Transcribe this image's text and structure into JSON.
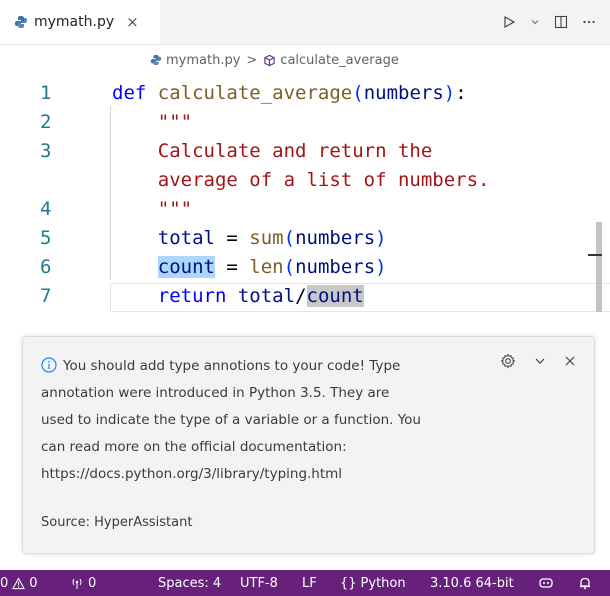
{
  "tab": {
    "filename": "mymath.py",
    "close": "×"
  },
  "breadcrumb": {
    "file": "mymath.py",
    "separator": ">",
    "symbol": "calculate_average"
  },
  "editor": {
    "lines": [
      {
        "num": "1",
        "parts": [
          {
            "t": "def",
            "c": "kw"
          },
          {
            "t": " "
          },
          {
            "t": "calculate_average",
            "c": "fn"
          },
          {
            "t": "(",
            "c": "paren"
          },
          {
            "t": "numbers",
            "c": "var"
          },
          {
            "t": ")",
            "c": "paren"
          },
          {
            "t": ":"
          }
        ]
      },
      {
        "num": "2",
        "parts": [
          {
            "t": "    \"\"\"",
            "c": "str"
          }
        ]
      },
      {
        "num": "3",
        "parts": [
          {
            "t": "    Calculate and return the",
            "c": "str"
          }
        ]
      },
      {
        "num": "",
        "parts": [
          {
            "t": "    average of a list of numbers.",
            "c": "str"
          }
        ]
      },
      {
        "num": "4",
        "parts": [
          {
            "t": "    \"\"\"",
            "c": "str"
          }
        ]
      },
      {
        "num": "5",
        "parts": [
          {
            "t": "    "
          },
          {
            "t": "total",
            "c": "var"
          },
          {
            "t": " = "
          },
          {
            "t": "sum",
            "c": "fn"
          },
          {
            "t": "(",
            "c": "paren"
          },
          {
            "t": "numbers",
            "c": "var"
          },
          {
            "t": ")",
            "c": "paren"
          }
        ]
      },
      {
        "num": "6",
        "parts": [
          {
            "t": "    "
          },
          {
            "t": "count",
            "c": "var hl"
          },
          {
            "t": " = "
          },
          {
            "t": "len",
            "c": "fn"
          },
          {
            "t": "(",
            "c": "paren"
          },
          {
            "t": "numbers",
            "c": "var"
          },
          {
            "t": ")",
            "c": "paren"
          }
        ]
      },
      {
        "num": "7",
        "parts": [
          {
            "t": "    "
          },
          {
            "t": "return",
            "c": "kw"
          },
          {
            "t": " "
          },
          {
            "t": "total",
            "c": "var"
          },
          {
            "t": "/"
          },
          {
            "t": "count",
            "c": "var hl2"
          }
        ]
      }
    ]
  },
  "notification": {
    "lines": [
      "You should add type annotions to your code! Type",
      "annotation were introduced in Python 3.5. They are",
      "used to indicate the type of a variable or a function. You",
      "can read more on the official documentation:",
      "https://docs.python.org/3/library/typing.html"
    ],
    "source": "Source: HyperAssistant"
  },
  "statusbar": {
    "errors": "0",
    "warnings": "0",
    "ports": "0",
    "spaces": "Spaces: 4",
    "encoding": "UTF-8",
    "eol": "LF",
    "language": "Python",
    "interpreter": "3.10.6 64-bit",
    "language_prefix": "{}"
  },
  "colors": {
    "statusbar": "#68217a",
    "keyword": "#0000ff",
    "string": "#a31515",
    "function": "#795e26"
  }
}
